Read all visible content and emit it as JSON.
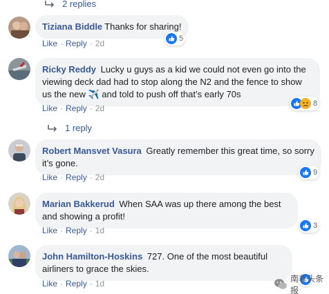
{
  "replies_top": {
    "label": "2 replies"
  },
  "replies_mid": {
    "label": "1 reply"
  },
  "actions": {
    "like": "Like",
    "reply": "Reply",
    "sep": "·"
  },
  "comments": [
    {
      "author": "Tiziana Biddle",
      "text": "Thanks for sharing!",
      "reactions": "5",
      "time": "2d"
    },
    {
      "author": "Ricky Reddy",
      "text": "Lucky u guys as a kid we could not even go into the viewing deck dad had to stop along the N2 and the fence to show us the new ✈️ and told to push off that’s early 70s",
      "reactions": "8",
      "time": "2d"
    },
    {
      "author": "Robert Mansvet Vasura",
      "text": "Greatly remember this great time, so sorry it’s gone.",
      "reactions": "9",
      "time": "2d"
    },
    {
      "author": "Marian Bakkerud",
      "text": "When SAA was up there among the best and showing a profit!",
      "reactions": "3",
      "time": "1d"
    },
    {
      "author": "John Hamilton-Hoskins",
      "text": "727. One of the most beautiful airliners to grace the skies.",
      "reactions": "",
      "time": "1d"
    }
  ],
  "watermark": {
    "text": "南非头条报"
  },
  "colors": {
    "link": "#385898",
    "bubble": "#f2f3f5",
    "meta": "#90949c",
    "like_blue": "#1877f2"
  }
}
